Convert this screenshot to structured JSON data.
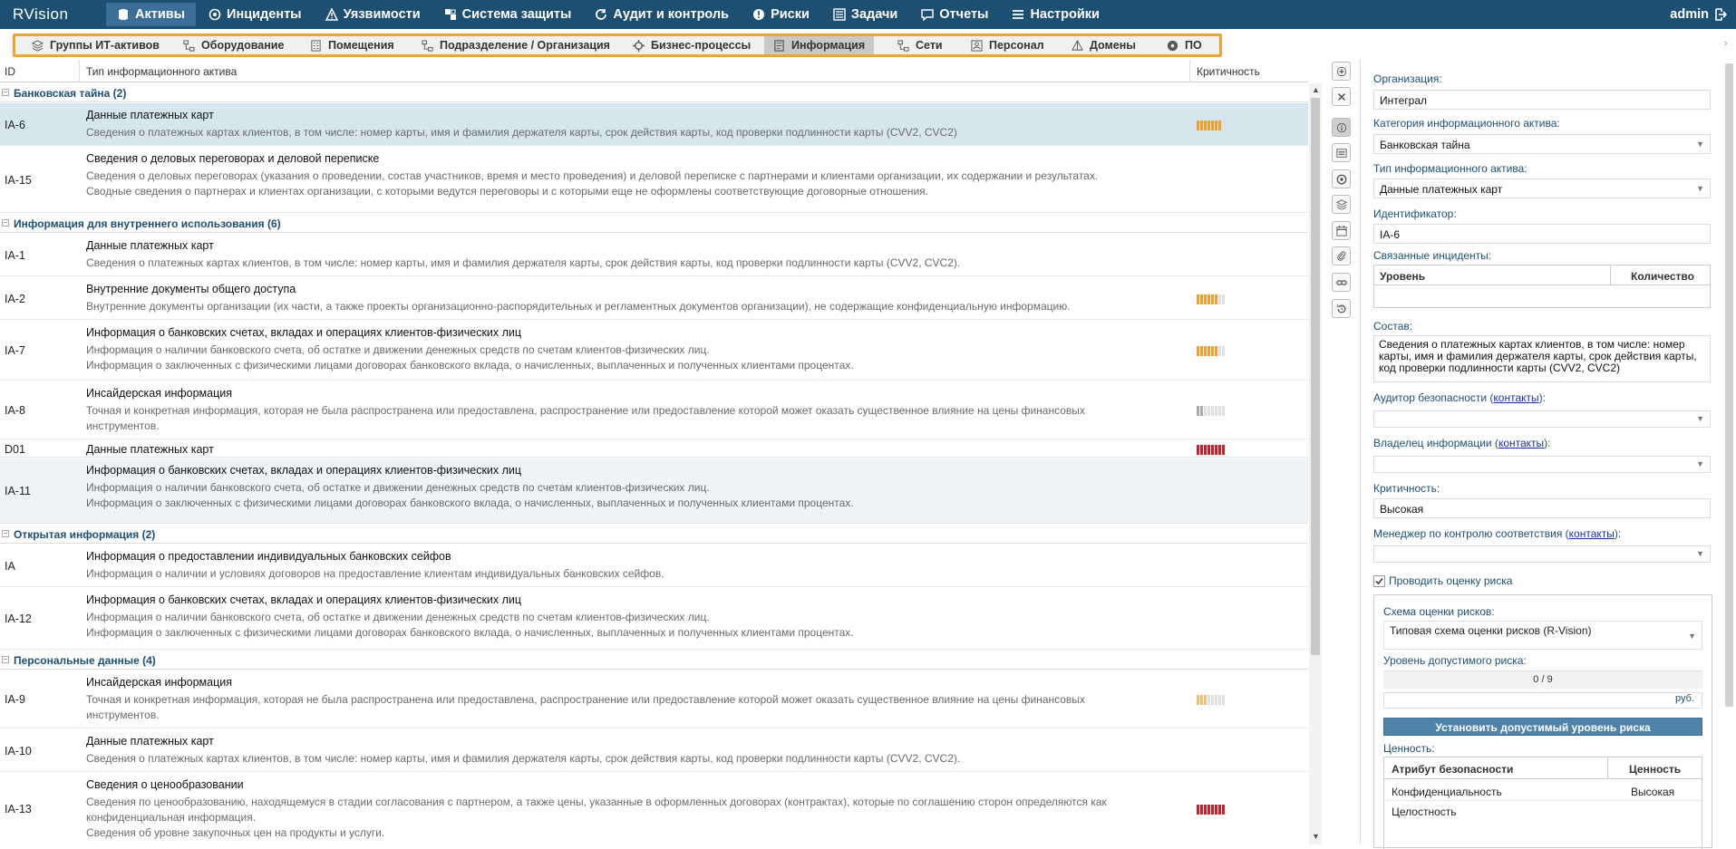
{
  "app": {
    "logo": "RVision",
    "user": "admin"
  },
  "nav": [
    {
      "label": "Активы",
      "icon": "database-icon",
      "active": true
    },
    {
      "label": "Инциденты",
      "icon": "target-icon"
    },
    {
      "label": "Уязвимости",
      "icon": "warning-icon"
    },
    {
      "label": "Система защиты",
      "icon": "blocks-icon"
    },
    {
      "label": "Аудит и контроль",
      "icon": "refresh-icon"
    },
    {
      "label": "Риски",
      "icon": "alert-circle-icon"
    },
    {
      "label": "Задачи",
      "icon": "checklist-icon"
    },
    {
      "label": "Отчеты",
      "icon": "chat-icon"
    },
    {
      "label": "Настройки",
      "icon": "menu-icon"
    }
  ],
  "subnav": [
    {
      "label": "Группы ИТ-активов",
      "icon": "layers-icon"
    },
    {
      "label": "Оборудование",
      "icon": "network-icon"
    },
    {
      "label": "Помещения",
      "icon": "building-icon"
    },
    {
      "label": "Подразделение / Организация",
      "icon": "org-icon"
    },
    {
      "label": "Бизнес-процессы",
      "icon": "gear-icon"
    },
    {
      "label": "Информация",
      "icon": "document-icon",
      "active": true
    },
    {
      "label": "Сети",
      "icon": "network-icon"
    },
    {
      "label": "Персонал",
      "icon": "person-icon"
    },
    {
      "label": "Домены",
      "icon": "pyramid-icon"
    },
    {
      "label": "ПО",
      "icon": "disc-icon"
    }
  ],
  "table": {
    "headers": {
      "id": "ID",
      "type": "Тип информационного актива",
      "criticality": "Критичность"
    },
    "groups": [
      {
        "label": "Банковская тайна (2)"
      },
      {
        "label": "Информация для внутреннего использования (6)"
      },
      {
        "label": "Открытая информация (2)"
      },
      {
        "label": "Персональные данные (4)"
      }
    ],
    "rows": [
      {
        "id": "IA-6",
        "title": "Данные платежных карт",
        "desc": [
          "Сведения о платежных картах клиентов, в том числе: номер карты, имя и фамилия держателя карты, срок действия карты, код проверки подлинности карты (CVV2, CVC2)"
        ],
        "crit": 7,
        "crit_color": "#f0a030"
      },
      {
        "id": "IA-15",
        "title": "Сведения о деловых переговорах и деловой переписке",
        "desc": [
          "Сведения о деловых переговорах (указания о проведении, состав участников, время и место проведения) и деловой переписке с партнерами и клиентами организации, их содержании и результатах.",
          "Сводные сведения о партнерах и клиентах организации, с которыми ведутся переговоры и с которыми еще не оформлены соответствующие договорные отношения."
        ],
        "crit": 0
      },
      {
        "id": "IA-1",
        "title": "Данные платежных карт",
        "desc": [
          "Сведения о платежных картах клиентов, в том числе: номер карты, имя и фамилия держателя карты, срок действия карты, код проверки подлинности карты (CVV2, CVC2)."
        ],
        "crit": 0
      },
      {
        "id": "IA-2",
        "title": "Внутренние документы общего доступа",
        "desc": [
          "Внутренние документы организации (их части, а также проекты организационно-распорядительных и регламентных документов организации), не содержащие конфиденциальную информацию."
        ],
        "crit": 6,
        "crit_color": "#f0a030"
      },
      {
        "id": "IA-7",
        "title": "Информация о банковских счетах, вкладах и операциях клиентов-физических лиц",
        "desc": [
          "Информация о наличии банковского счета, об остатке и движении денежных средств по счетам клиентов-физических лиц.",
          "Информация о заключенных с физическими лицами договорах банковского вклада, о начисленных, выплаченных и полученных клиентами процентах."
        ],
        "crit": 6,
        "crit_color": "#f0a030"
      },
      {
        "id": "IA-8",
        "title": "Инсайдерская информация",
        "desc": [
          "Точная и конкретная информация, которая не была распространена или предоставлена, распространение или предоставление которой может оказать существенное влияние на цены финансовых",
          "инструментов."
        ],
        "crit": 2,
        "crit_color": "#aaaaaa"
      },
      {
        "id": "D01",
        "title": "Данные платежных карт",
        "desc": [],
        "crit": 8,
        "crit_color": "#c8202a"
      },
      {
        "id": "IA-11",
        "title": "Информация о банковских счетах, вкладах и операциях клиентов-физических лиц",
        "desc": [
          "Информация о наличии банковского счета, об остатке и движении денежных средств по счетам клиентов-физических лиц.",
          "Информация о заключенных с физическими лицами договорах банковского вклада, о начисленных, выплаченных и полученных клиентами процентах."
        ],
        "crit": 0
      },
      {
        "id": "IA",
        "title": "Информация о предоставлении индивидуальных банковских сейфов",
        "desc": [
          "Информация о наличии и условиях договоров на предоставление клиентам индивидуальных банковских сейфов."
        ],
        "crit": 0
      },
      {
        "id": "IA-12",
        "title": "Информация о банковских счетах, вкладах и операциях клиентов-физических лиц",
        "desc": [
          "Информация о наличии банковского счета, об остатке и движении денежных средств по счетам клиентов-физических лиц.",
          "Информация о заключенных с физическими лицами договорах банковского вклада, о начисленных, выплаченных и полученных клиентами процентах."
        ],
        "crit": 0
      },
      {
        "id": "IA-9",
        "title": "Инсайдерская информация",
        "desc": [
          "Точная и конкретная информация, которая не была распространена или предоставлена, распространение или предоставление которой может оказать существенное влияние на цены финансовых",
          "инструментов."
        ],
        "crit": 3,
        "crit_color": "#f0c070"
      },
      {
        "id": "IA-10",
        "title": "Данные платежных карт",
        "desc": [
          "Сведения о платежных картах клиентов, в том числе: номер карты, имя и фамилия держателя карты, срок действия карты, код проверки подлинности карты (CVV2, CVC2)."
        ],
        "crit": 0
      },
      {
        "id": "IA-13",
        "title": "Сведения о ценообразовании",
        "desc": [
          "Сведения по ценообразованию, находящемуся в стадии согласования с партнером, а также цены, указанные в оформленных договорах (контрактах), которые по соглашению сторон определяются как",
          "конфиденциальная информация.",
          "Сведения об уровне закупочных цен на продукты и услуги."
        ],
        "crit": 8,
        "crit_color": "#c8202a"
      }
    ]
  },
  "tools": [
    "add-icon",
    "close-icon",
    "info-icon",
    "list-icon",
    "target-icon",
    "layers-icon",
    "calendar-icon",
    "paperclip-icon",
    "link-icon",
    "history-icon"
  ],
  "panel": {
    "org_label": "Организация:",
    "org_value": "Интеграл",
    "cat_label": "Категория информационного актива:",
    "cat_value": "Банковская тайна",
    "type_label": "Тип информационного актива:",
    "type_value": "Данные платежных карт",
    "id_label": "Идентификатор:",
    "id_value": "IA-6",
    "incidents_label": "Связанные инциденты:",
    "incidents_col1": "Уровень",
    "incidents_col2": "Количество",
    "comp_label": "Состав:",
    "comp_value": "Сведения о платежных картах клиентов, в том числе: номер карты, имя и фамилия держателя карты, срок действия карты, код проверки подлинности карты (CVV2, CVC2)",
    "auditor_label": "Аудитор безопасности (",
    "contacts": "контакты",
    "close_paren": "):",
    "owner_label": "Владелец информации (",
    "crit_label": "Критичность:",
    "crit_value": "Высокая",
    "manager_label": "Менеджер по контролю соответствия (",
    "risk_check": "Проводить оценку риска",
    "scheme_label": "Схема оценки рисков:",
    "scheme_value": "Типовая схема оценки рисков (R-Vision)",
    "level_label": "Уровень допустимого риска:",
    "level_value": "0 / 9",
    "currency": "руб.",
    "set_button": "Установить допустимый уровень риска",
    "value_label": "Ценность:",
    "value_col1": "Атрибут безопасности",
    "value_col2": "Ценность",
    "value_rows": [
      {
        "attr": "Конфиденциальность",
        "val": "Высокая"
      },
      {
        "attr": "Целостность",
        "val": ""
      }
    ]
  }
}
